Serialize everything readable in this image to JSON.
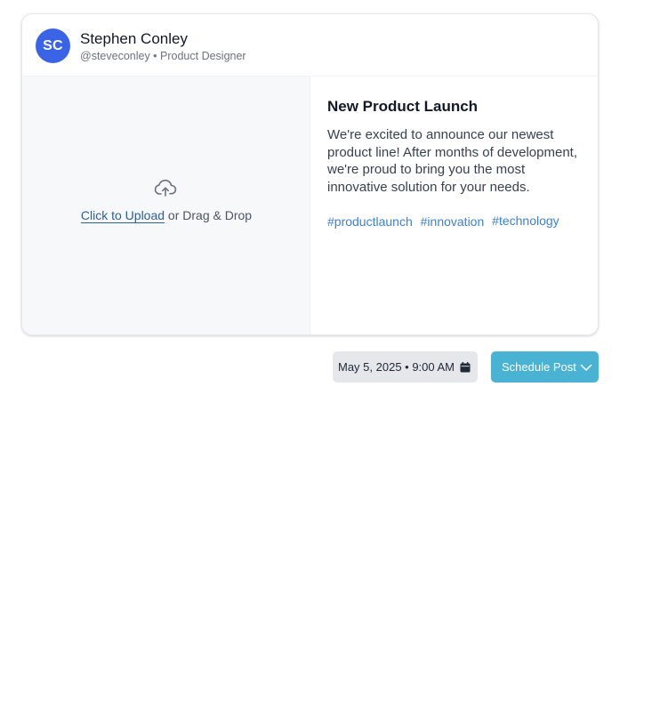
{
  "profile": {
    "initials": "SC",
    "name": "Stephen Conley",
    "meta": "@steveconley • Product Designer",
    "avatar_color": "#3b63e6"
  },
  "upload": {
    "icon": "cloud-upload-icon",
    "link_label": "Click to Upload",
    "suffix": " or Drag & Drop"
  },
  "post": {
    "title": "New Product Launch",
    "body": "We're excited to announce our newest product line! After months of development, we're proud to bring you the most innovative solution for your needs.",
    "tags": [
      "#productlaunch",
      "#innovation",
      "#technology"
    ],
    "tag_color": "#3b82d6"
  },
  "schedule": {
    "datetime": "May 5, 2025 • 9:00 AM",
    "calendar_icon": "calendar-icon",
    "button_label": "Schedule Post",
    "button_icon": "chevron-down-icon",
    "button_color": "#4ab3d4"
  }
}
